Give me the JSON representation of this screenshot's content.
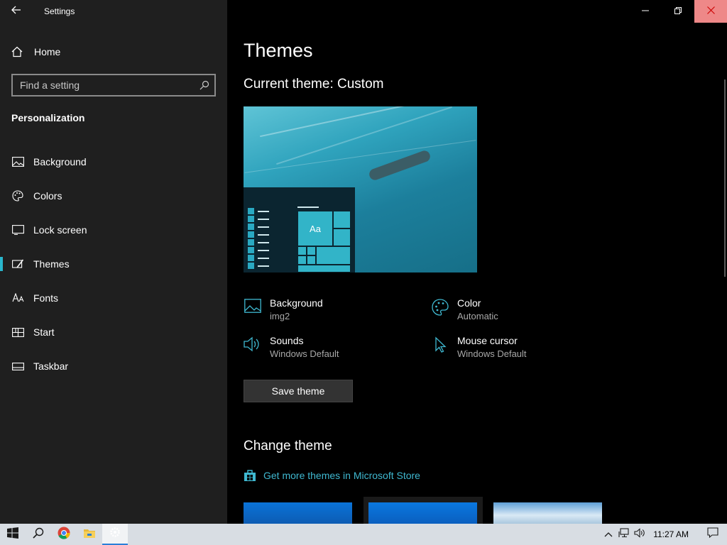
{
  "window": {
    "title": "Settings",
    "back_icon": "back-arrow-icon",
    "controls": [
      "minimize-icon",
      "restore-icon",
      "close-icon"
    ]
  },
  "sidebar": {
    "home_label": "Home",
    "search_placeholder": "Find a setting",
    "section_title": "Personalization",
    "items": [
      {
        "label": "Background",
        "icon": "picture-icon",
        "active": false
      },
      {
        "label": "Colors",
        "icon": "palette-icon",
        "active": false
      },
      {
        "label": "Lock screen",
        "icon": "lock-screen-icon",
        "active": false
      },
      {
        "label": "Themes",
        "icon": "themes-icon",
        "active": true
      },
      {
        "label": "Fonts",
        "icon": "fonts-icon",
        "active": false
      },
      {
        "label": "Start",
        "icon": "start-icon",
        "active": false
      },
      {
        "label": "Taskbar",
        "icon": "taskbar-icon",
        "active": false
      }
    ]
  },
  "main": {
    "title": "Themes",
    "current_theme": "Current theme: Custom",
    "preview_tile_text": "Aa",
    "settings": [
      {
        "label": "Background",
        "value": "img2",
        "icon": "picture-icon"
      },
      {
        "label": "Color",
        "value": "Automatic",
        "icon": "palette-icon"
      },
      {
        "label": "Sounds",
        "value": "Windows Default",
        "icon": "speaker-icon"
      },
      {
        "label": "Mouse cursor",
        "value": "Windows Default",
        "icon": "cursor-icon"
      }
    ],
    "save_button": "Save theme",
    "change_title": "Change theme",
    "store_link": "Get more themes in Microsoft Store"
  },
  "taskbar": {
    "clock": "11:27 AM",
    "apps": [
      "windows-start-icon",
      "search-icon",
      "chrome-icon",
      "file-explorer-icon",
      "settings-icon"
    ]
  },
  "colors": {
    "accent": "#29b6cc",
    "link": "#3fb8d0",
    "close_hover": "#e88888"
  }
}
